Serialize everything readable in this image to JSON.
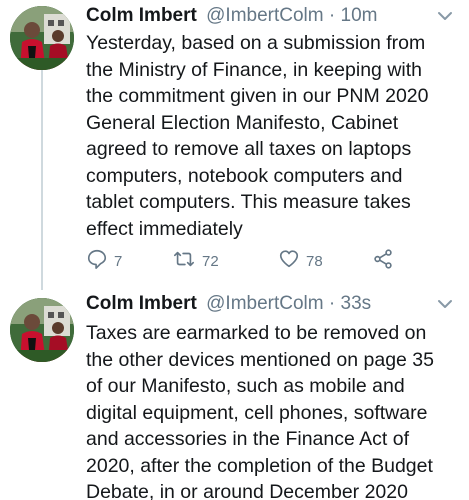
{
  "tweets": [
    {
      "author_name": "Colm Imbert",
      "handle": "@ImbertColm",
      "separator": "·",
      "time": "10m",
      "text": "Yesterday, based on a submission from\nthe Ministry of Finance, in keeping with\nthe commitment given in our PNM 2020\nGeneral Election Manifesto, Cabinet\nagreed to remove all taxes on laptops\ncomputers, notebook computers and\ntablet computers. This measure takes\neffect immediately",
      "replies": "7",
      "retweets": "72",
      "likes": "78",
      "icons": {
        "reply": "reply-icon",
        "retweet": "retweet-icon",
        "like": "heart-icon",
        "share": "share-icon",
        "menu": "chevron-down-icon"
      }
    },
    {
      "author_name": "Colm Imbert",
      "handle": "@ImbertColm",
      "separator": "·",
      "time": "33s",
      "text": "Taxes are earmarked to be removed on\nthe other devices mentioned on page 35\nof our Manifesto, such as mobile and\ndigital equipment, cell phones, software\nand accessories in the Finance Act of\n2020, after the completion of the Budget\nDebate, in or around December 2020",
      "icons": {
        "menu": "chevron-down-icon"
      }
    }
  ],
  "colors": {
    "text": "#14171a",
    "secondary": "#657786",
    "thread_line": "#cfd9de"
  }
}
